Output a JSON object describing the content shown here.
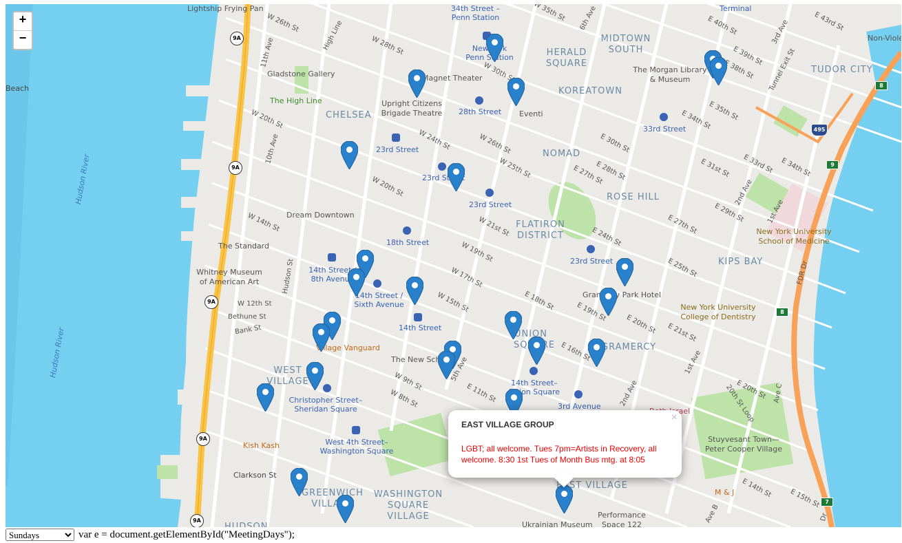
{
  "map": {
    "zoom_in_label": "+",
    "zoom_out_label": "−",
    "colors": {
      "water": "#75cff0",
      "land": "#eceae6",
      "street": "#ffffff",
      "highway": "#f9c445",
      "park": "#bde3a8",
      "marker": "#2a81cb",
      "transit_label": "#3a63b4",
      "district_label": "#6a8aa4"
    },
    "districts": [
      "CHELSEA",
      "HERALD SQUARE",
      "MIDTOWN SOUTH",
      "KOREATOWN",
      "NOMAD",
      "ROSE HILL",
      "FLATIRON DISTRICT",
      "KIPS BAY",
      "TUDOR CITY",
      "GRAMERCY",
      "UNION SQUARE",
      "WEST VILLAGE",
      "GREENWICH VILLAGE",
      "WASHINGTON SQUARE VILLAGE",
      "HUDSON",
      "EAST VILLAGE"
    ],
    "water_labels": [
      "Hudson River",
      "Hudson River",
      "Beach"
    ],
    "transit": [
      "34th Street – Penn Station",
      "New York Penn Station",
      "28th Street",
      "23rd Street",
      "23rd Street",
      "23rd Street",
      "33rd Street",
      "23rd Street",
      "18th Street",
      "14th Street / 8th Avenue",
      "14th Street / Sixth Avenue",
      "14th Street",
      "14th Street–Union Square",
      "3rd Avenue",
      "Christopher Street–Sheridan Square",
      "West 4th Street–Washington Square",
      "Terminal"
    ],
    "places": [
      "Lightship Frying Pan",
      "Gladstone Gallery",
      "The High Line",
      "Upright Citizens Brigade Theatre",
      "Magnet Theater",
      "Eventi",
      "The Morgan Library & Museum",
      "Dream Downtown",
      "The Standard",
      "Whitney Museum of American Art",
      "Gramercy Park Hotel",
      "New York University School of Medicine",
      "New York University College of Dentistry",
      "Village Vanguard",
      "The New School",
      "Kish Kash",
      "Stuyvesant Town—Peter Cooper Village",
      "Beth Israel",
      "M & J",
      "Performance Space 122",
      "Ukrainian Museum",
      "Non-Viole"
    ],
    "streets": [
      "W 26th St",
      "W 28th St",
      "High Line",
      "11th Ave",
      "W 20th St",
      "10th Ave",
      "W 14th St",
      "W 12th St",
      "Bethune St",
      "Bank St",
      "Hudson St",
      "Clarkson St",
      "W 30th St",
      "W 24th St",
      "W 26th St",
      "W 25th St",
      "W 20th St",
      "W 21st St",
      "W 19th St",
      "W 17th St",
      "W 15th St",
      "E 18th St",
      "W 9th St",
      "W 8th St",
      "E 11th St",
      "5th Ave",
      "W 35th St",
      "6th Ave",
      "E 40th St",
      "E 39th St",
      "E 38th St",
      "3rd Ave",
      "E 43rd St",
      "Tunnel Exit St",
      "E 35th St",
      "E 34th St",
      "E 30th St",
      "E 28th St",
      "E 27th St",
      "E 31st St",
      "E 33rd St",
      "E 34th St",
      "2nd Ave",
      "1st Ave",
      "E 29th St",
      "E 27th St",
      "E 25th St",
      "E 24th St",
      "E 19th St",
      "E 20th St",
      "E 21st St",
      "E 16th St",
      "2nd Ave",
      "1st Ave",
      "E 20th St",
      "20th St Loop",
      "Ave C",
      "E 14th St",
      "E 15th St",
      "FDR Dr",
      "Ave B",
      "Dr"
    ],
    "route_shields": [
      "9A",
      "9A",
      "9A",
      "9A",
      "9A",
      "9A"
    ],
    "interstate_shield": "495",
    "exit_signs": [
      "8",
      "9",
      "8",
      "7"
    ],
    "marker_count": 29
  },
  "popup": {
    "title": "EAST VILLAGE GROUP",
    "body": "LGBT; all welcome. Tues 7pm=Artists in Recovery, all welcome. 8:30 1st Tues of Month Bus mtg. at 8:05",
    "close_label": "×"
  },
  "controls": {
    "day_select": {
      "selected": "Sundays",
      "options": [
        "Sundays"
      ]
    },
    "stray_text": "var e = document.getElementById(\"MeetingDays\");"
  }
}
